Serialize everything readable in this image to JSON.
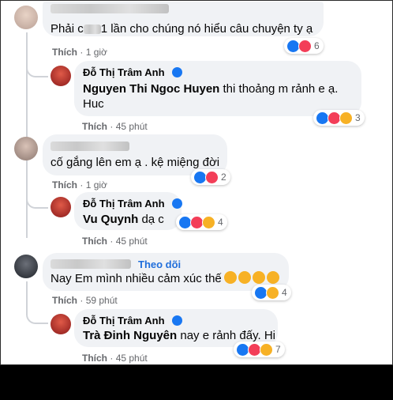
{
  "comments": [
    {
      "author": "Nguyen Thi Ngoc Huyen",
      "text_before": "Phải c",
      "text_after": "1 lần cho chúng nó hiểu câu chuyện ty ạ",
      "like": "Thích",
      "time": "1 giờ",
      "reactions": [
        "like-icon",
        "heart-icon"
      ],
      "reaction_count": "6"
    },
    {
      "author": "Đỗ Thị Trâm Anh",
      "mention": "Nguyen Thi Ngoc Huyen",
      "text": " thi thoảng m rảnh e ạ.",
      "text_line2": "Huc",
      "like": "Thích",
      "time": "45 phút",
      "reactions": [
        "like-icon",
        "heart-icon",
        "haha-icon"
      ],
      "reaction_count": "3"
    },
    {
      "text": "cố gắng lên em ạ . kệ miệng đời",
      "like": "Thích",
      "time": "1 giờ",
      "reactions": [
        "like-icon",
        "heart-icon"
      ],
      "reaction_count": "2"
    },
    {
      "author": "Đỗ Thị Trâm Anh",
      "mention": "Vu Quynh",
      "text": " dạ c",
      "like": "Thích",
      "time": "45 phút",
      "reactions": [
        "like-icon",
        "heart-icon",
        "haha-icon"
      ],
      "reaction_count": "4"
    },
    {
      "follow": "Theo dõi",
      "text": "Nay Em mình nhiều cảm xúc thế",
      "like": "Thích",
      "time": "59 phút",
      "reactions": [
        "like-icon",
        "sad-icon"
      ],
      "reaction_count": "4"
    },
    {
      "author": "Đỗ Thị Trâm Anh",
      "mention": "Trà Đinh Nguyên",
      "text": " nay e rảnh đấy. Hi",
      "like": "Thích",
      "time": "45 phút",
      "reactions": [
        "like-icon",
        "heart-icon",
        "haha-icon"
      ],
      "reaction_count": "7"
    }
  ],
  "separator": "·",
  "colors": {
    "like": "#1877f2",
    "heart": "#f33e58",
    "haha": "#f7b125",
    "bubble": "#f0f2f5",
    "follow": "#216fdb"
  }
}
